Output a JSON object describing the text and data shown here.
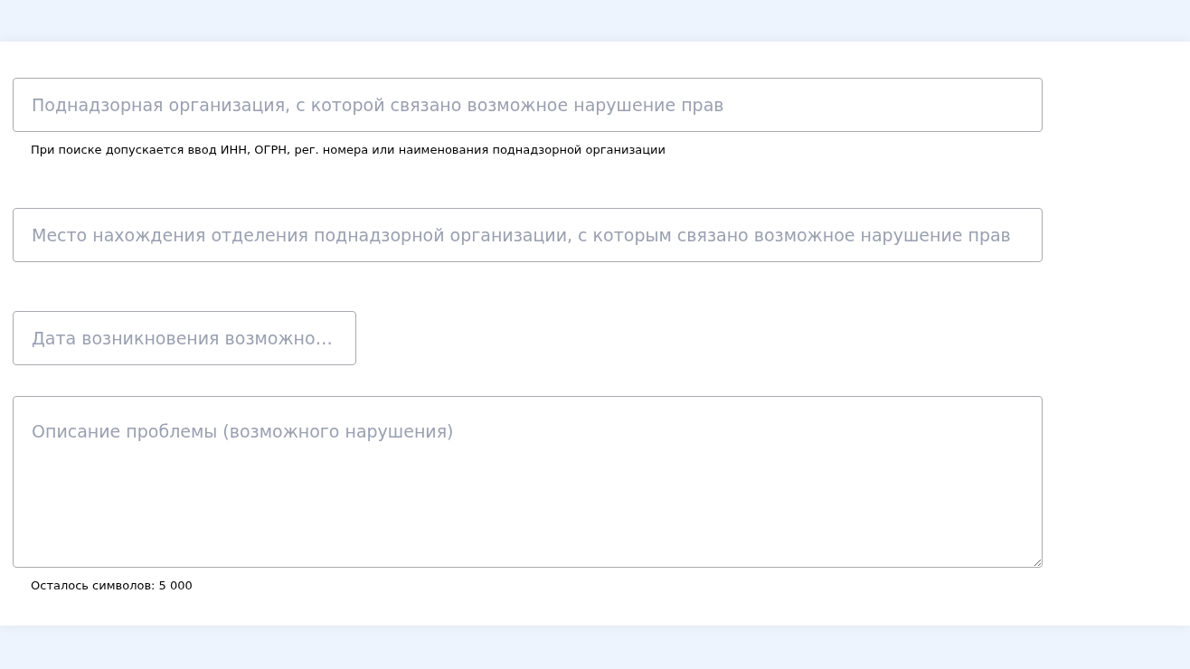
{
  "fields": [
    {
      "kind": "input",
      "placeholder": "Поднадзорная организация, с которой связано возможное нарушение прав",
      "hint": "При поиске допускается ввод ИНН, ОГРН, рег. номера или наименования поднадзорной организации"
    },
    {
      "kind": "input",
      "placeholder": "Место нахождения отделения поднадзорной организации, с которым связано возможное нарушение прав"
    },
    {
      "kind": "date",
      "placeholder": "Дата возникновения возможно…"
    },
    {
      "kind": "textarea",
      "placeholder": "Описание проблемы (возможного нарушения)",
      "hint": "Осталось символов: 5 000"
    }
  ]
}
